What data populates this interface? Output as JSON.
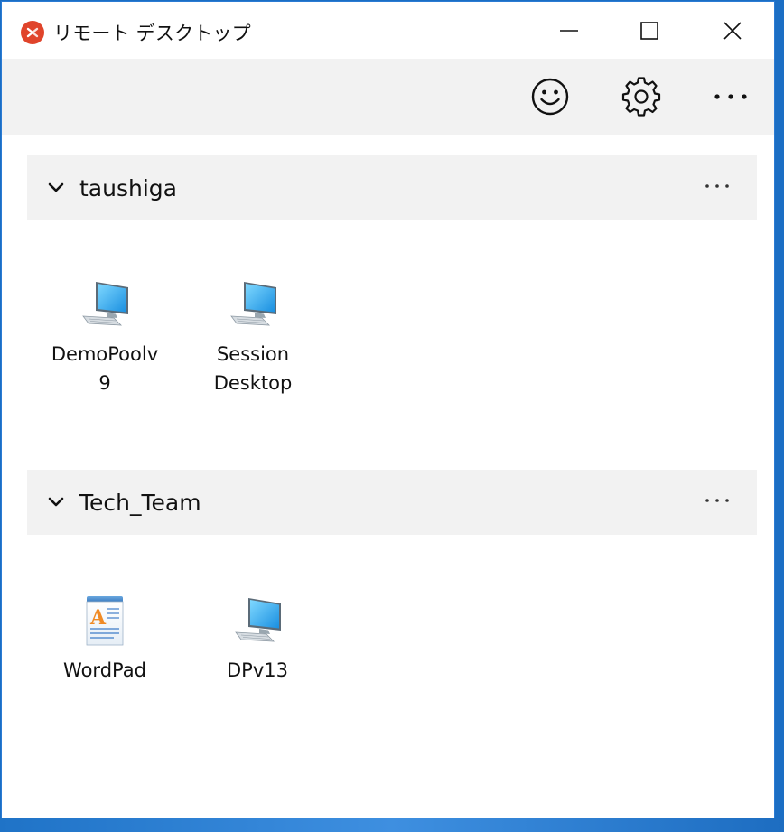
{
  "window": {
    "title": "リモート デスクトップ"
  },
  "titlebar_buttons": {
    "minimize_icon": "minimize-icon",
    "maximize_icon": "maximize-icon",
    "close_icon": "close-icon"
  },
  "toolbar": {
    "feedback_icon": "smiley-icon",
    "settings_icon": "gear-icon",
    "more_icon": "more-icon"
  },
  "groups": [
    {
      "name": "taushiga",
      "items": [
        {
          "label": "DemoPoolv9",
          "icon": "desktop-computer-icon"
        },
        {
          "label": "Session Desktop",
          "icon": "desktop-computer-icon"
        }
      ]
    },
    {
      "name": "Tech_Team",
      "items": [
        {
          "label": "WordPad",
          "icon": "wordpad-icon"
        },
        {
          "label": "DPv13",
          "icon": "desktop-computer-icon"
        }
      ]
    }
  ],
  "colors": {
    "brand": "#e0442b",
    "toolbar_bg": "#f2f2f2",
    "group_header_bg": "#f2f2f2",
    "window_border": "#2b7bd3"
  }
}
